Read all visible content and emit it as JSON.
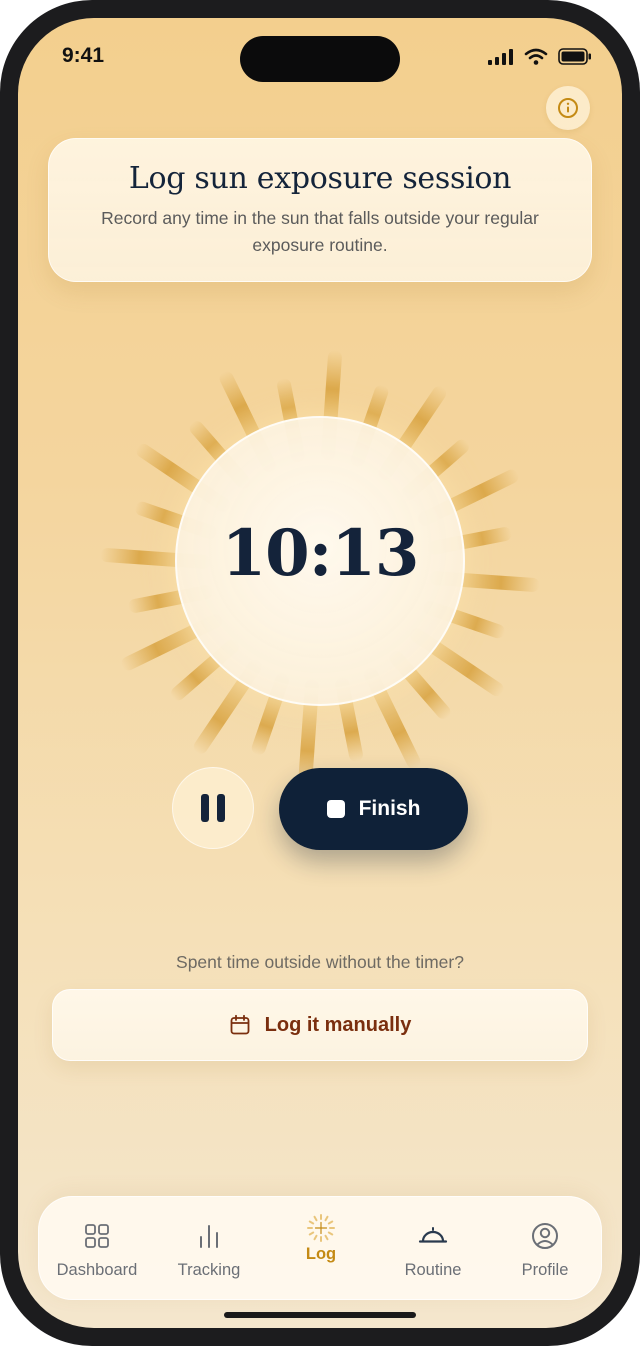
{
  "status_bar": {
    "time": "9:41"
  },
  "header": {
    "title": "Log sun exposure session",
    "subtitle": "Record any time in the sun that falls outside your regular exposure routine."
  },
  "timer": {
    "display": "10:13",
    "state": "running"
  },
  "controls": {
    "pause_icon": "pause-icon",
    "finish_label": "Finish"
  },
  "manual": {
    "prompt": "Spent time outside without the timer?",
    "button_label": "Log it manually",
    "icon": "calendar-icon"
  },
  "tabs": [
    {
      "label": "Dashboard",
      "icon": "grid-icon",
      "active": false
    },
    {
      "label": "Tracking",
      "icon": "bar-chart-icon",
      "active": false
    },
    {
      "label": "Log",
      "icon": "sun-plus-icon",
      "active": true
    },
    {
      "label": "Routine",
      "icon": "sunrise-icon",
      "active": false
    },
    {
      "label": "Profile",
      "icon": "user-circle-icon",
      "active": false
    }
  ],
  "colors": {
    "background_top": "#f3cf8e",
    "background_bottom": "#f4e6cd",
    "navy": "#0f2138",
    "accent": "#c48a14",
    "manual_text": "#7a2e0e"
  }
}
